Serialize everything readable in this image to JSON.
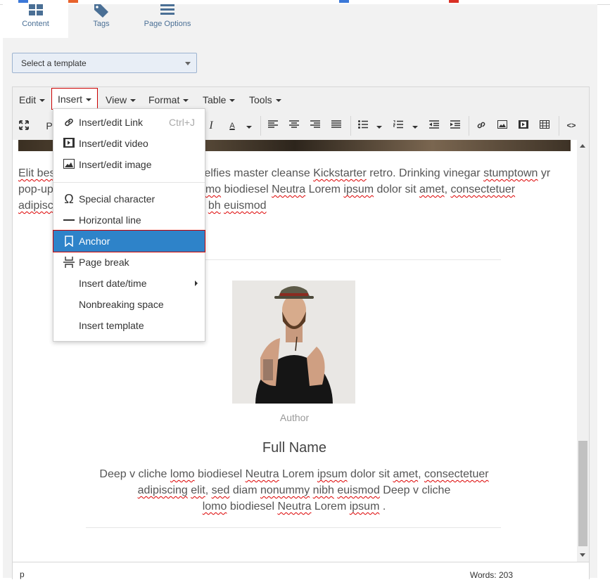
{
  "tabs": [
    {
      "label": "Content",
      "icon": "grid-icon"
    },
    {
      "label": "Tags",
      "icon": "tag-icon"
    },
    {
      "label": "Page Options",
      "icon": "menu-icon"
    }
  ],
  "template_select": {
    "value": "Select a template"
  },
  "menubar": {
    "edit": "Edit",
    "insert": "Insert",
    "view": "View",
    "format": "Format",
    "table": "Table",
    "tools": "Tools"
  },
  "toolbar": {
    "format_partial": "P",
    "italic": "I",
    "font_color": "A",
    "source_code": "<>"
  },
  "insert_menu": [
    {
      "label": "Insert/edit Link",
      "shortcut": "Ctrl+J",
      "icon": "link-icon"
    },
    {
      "label": "Insert/edit video",
      "icon": "video-icon"
    },
    {
      "label": "Insert/edit image",
      "icon": "image-icon"
    },
    {
      "label": "Special character",
      "icon": "omega-icon"
    },
    {
      "label": "Horizontal line",
      "icon": "horizontal-line-icon"
    },
    {
      "label": "Anchor",
      "icon": "bookmark-icon"
    },
    {
      "label": "Page break",
      "icon": "page-break-icon"
    },
    {
      "label": "Insert date/time",
      "has_submenu": true
    },
    {
      "label": "Nonbreaking space"
    },
    {
      "label": "Insert template"
    }
  ],
  "content": {
    "para_line1_a": "Elit bes",
    "para_line1_b": "selfies master cleanse ",
    "para_line1_c": "Kickstarter",
    "para_line1_d": " retro. Drinking vinegar ",
    "para_line1_e": "stumptown",
    "para_line1_f": " yr",
    "para_line2_a": "pop-up",
    "para_line2_b": "mo",
    "para_line2_c": " biodiesel ",
    "para_line2_d": "Neutra",
    "para_line2_e": " Lorem ",
    "para_line2_f": "ipsum",
    "para_line2_g": " dolor sit ",
    "para_line2_h": "amet",
    "para_line2_i": ", ",
    "para_line2_j": "consectetuer",
    "para_line3_a": "adipisc",
    "para_line3_b": "bh",
    "para_line3_c": " ",
    "para_line3_d": "euismod",
    "author_label": "Author",
    "full_name": "Full Name",
    "desc_1": "Deep v cliche ",
    "desc_2": "lomo",
    "desc_3": " biodiesel ",
    "desc_4": "Neutra",
    "desc_5": " Lorem ",
    "desc_6": "ipsum",
    "desc_7": " dolor sit ",
    "desc_8": "amet",
    "desc_9": ", ",
    "desc_10": "consectetuer",
    "desc_11": "adipiscing",
    "desc_12": " ",
    "desc_13": "elit",
    "desc_14": ", ",
    "desc_15": "sed",
    "desc_16": " diam ",
    "desc_17": "nonummy",
    "desc_18": " ",
    "desc_19": "nibh",
    "desc_20": " ",
    "desc_21": "euismod",
    "desc_22": " Deep v cliche",
    "desc_23": "lomo",
    "desc_24": " biodiesel ",
    "desc_25": "Neutra",
    "desc_26": " Lorem ",
    "desc_27": "ipsum",
    "desc_28": " ."
  },
  "status": {
    "path": "p",
    "words": "Words: 203"
  },
  "colors": {
    "accent": "#2e83c9",
    "tab_text": "#4a6f95",
    "highlight_border": "#cc0000"
  }
}
